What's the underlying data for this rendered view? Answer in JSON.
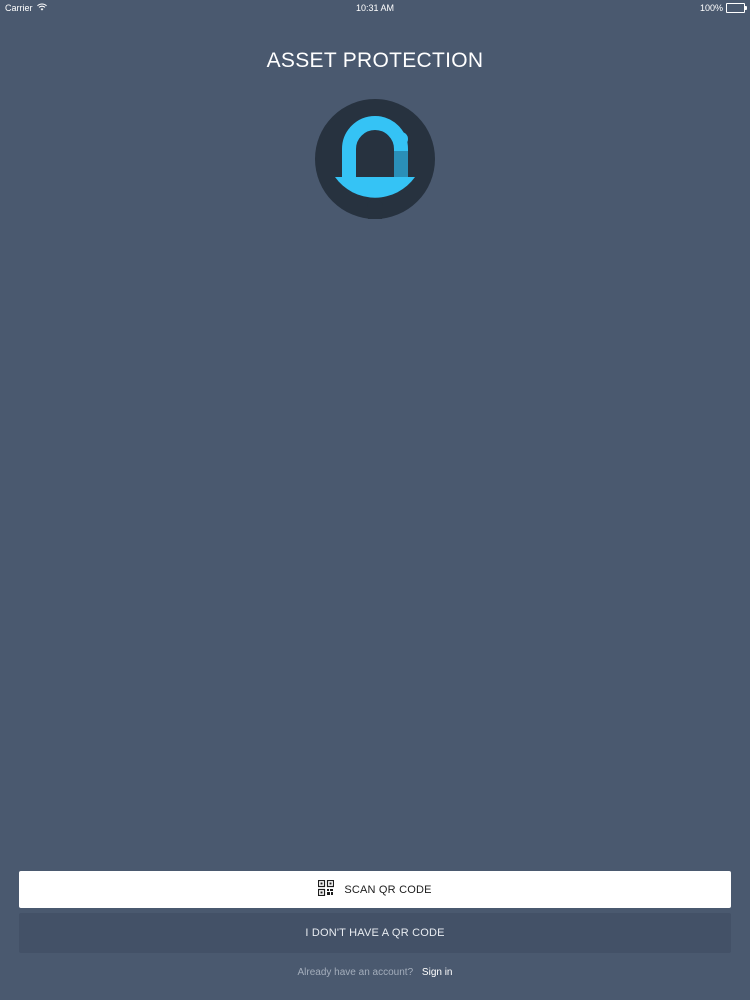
{
  "status_bar": {
    "carrier": "Carrier",
    "time": "10:31 AM",
    "battery": "100%",
    "battery_level": 1.0,
    "wifi_icon": "wifi-icon",
    "battery_icon": "battery-icon"
  },
  "header": {
    "title": "ASSET PROTECTION",
    "logo_icon": "padlock-logo-icon"
  },
  "actions": {
    "scan_label": "SCAN QR CODE",
    "scan_icon": "qr-code-icon",
    "no_qr_label": "I DON'T HAVE A QR CODE"
  },
  "signin": {
    "prompt": "Already have an account?",
    "link": "Sign in"
  },
  "colors": {
    "background": "#4a596f",
    "logo_circle": "#27323f",
    "logo_accent": "#35c3f5",
    "secondary_button": "#435167"
  }
}
